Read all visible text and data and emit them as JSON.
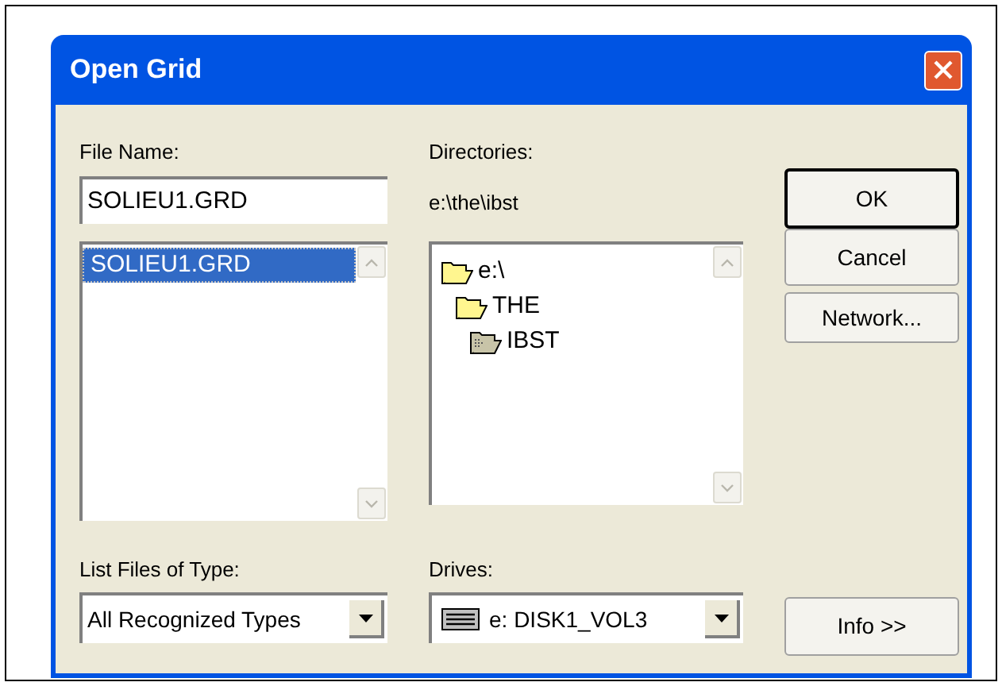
{
  "window": {
    "title": "Open Grid"
  },
  "file_name": {
    "label": "File Name:",
    "value": "SOLIEU1.GRD"
  },
  "files": [
    {
      "name": "SOLIEU1.GRD",
      "selected": true
    }
  ],
  "directories": {
    "label": "Directories:",
    "path": "e:\\the\\ibst",
    "items": [
      {
        "name": "e:\\",
        "current": false,
        "children": [
          {
            "name": "THE",
            "current": false,
            "children": [
              {
                "name": "IBST",
                "current": true
              }
            ]
          }
        ]
      }
    ]
  },
  "file_types": {
    "label": "List Files of Type:",
    "value": "All Recognized Types"
  },
  "drives": {
    "label": "Drives:",
    "value": "e: DISK1_VOL3"
  },
  "buttons": [
    {
      "label": "OK",
      "default": true
    },
    {
      "label": "Cancel",
      "default": false
    },
    {
      "label": "Network...",
      "default": false
    }
  ],
  "info_button": {
    "label": "Info >>"
  }
}
